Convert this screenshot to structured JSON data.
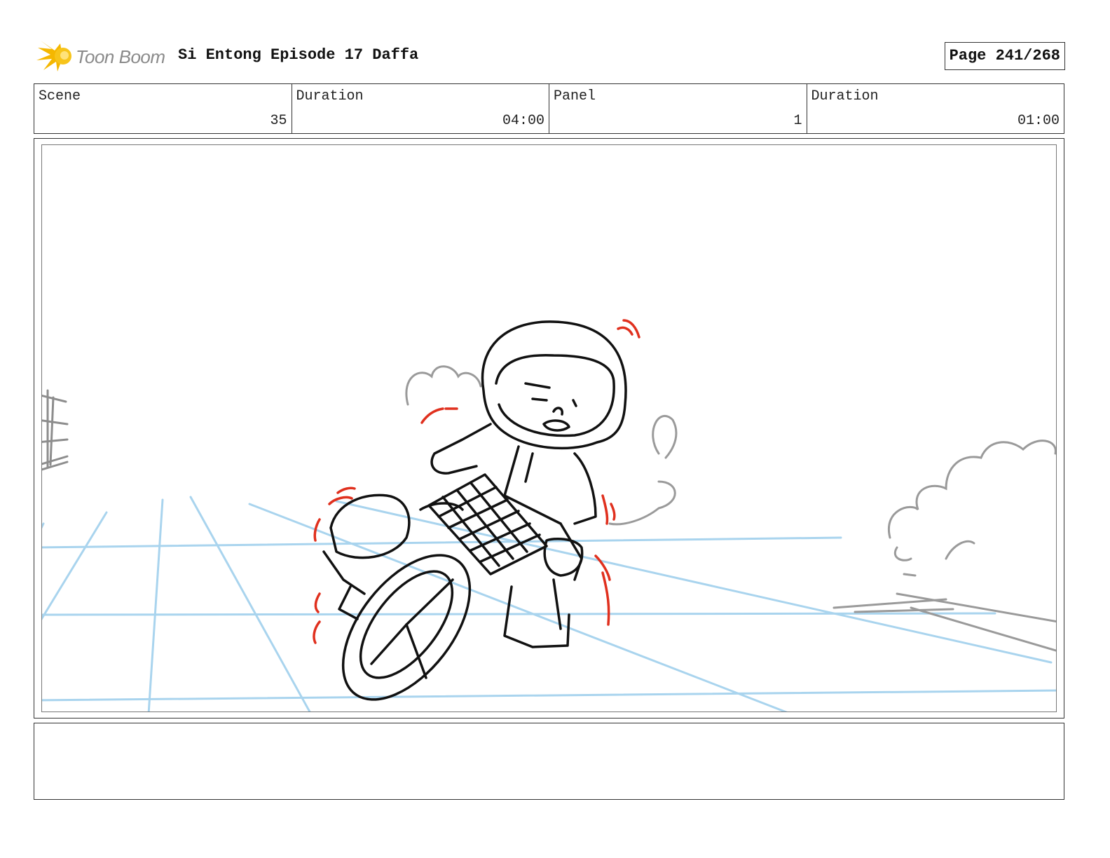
{
  "header": {
    "logo_text": "Toon Boom",
    "title": "Si Entong Episode 17 Daffa",
    "page": "Page 241/268"
  },
  "info": [
    {
      "label": "Scene",
      "value": "35"
    },
    {
      "label": "Duration",
      "value": "04:00"
    },
    {
      "label": "Panel",
      "value": "1"
    },
    {
      "label": "Duration",
      "value": "01:00"
    }
  ],
  "colors": {
    "logo_star": "#f5b700",
    "perspective_lines": "#a9d4ee",
    "action_marks": "#e0301e",
    "smoke": "#9a9a9a",
    "ink": "#111111"
  },
  "notes": ""
}
